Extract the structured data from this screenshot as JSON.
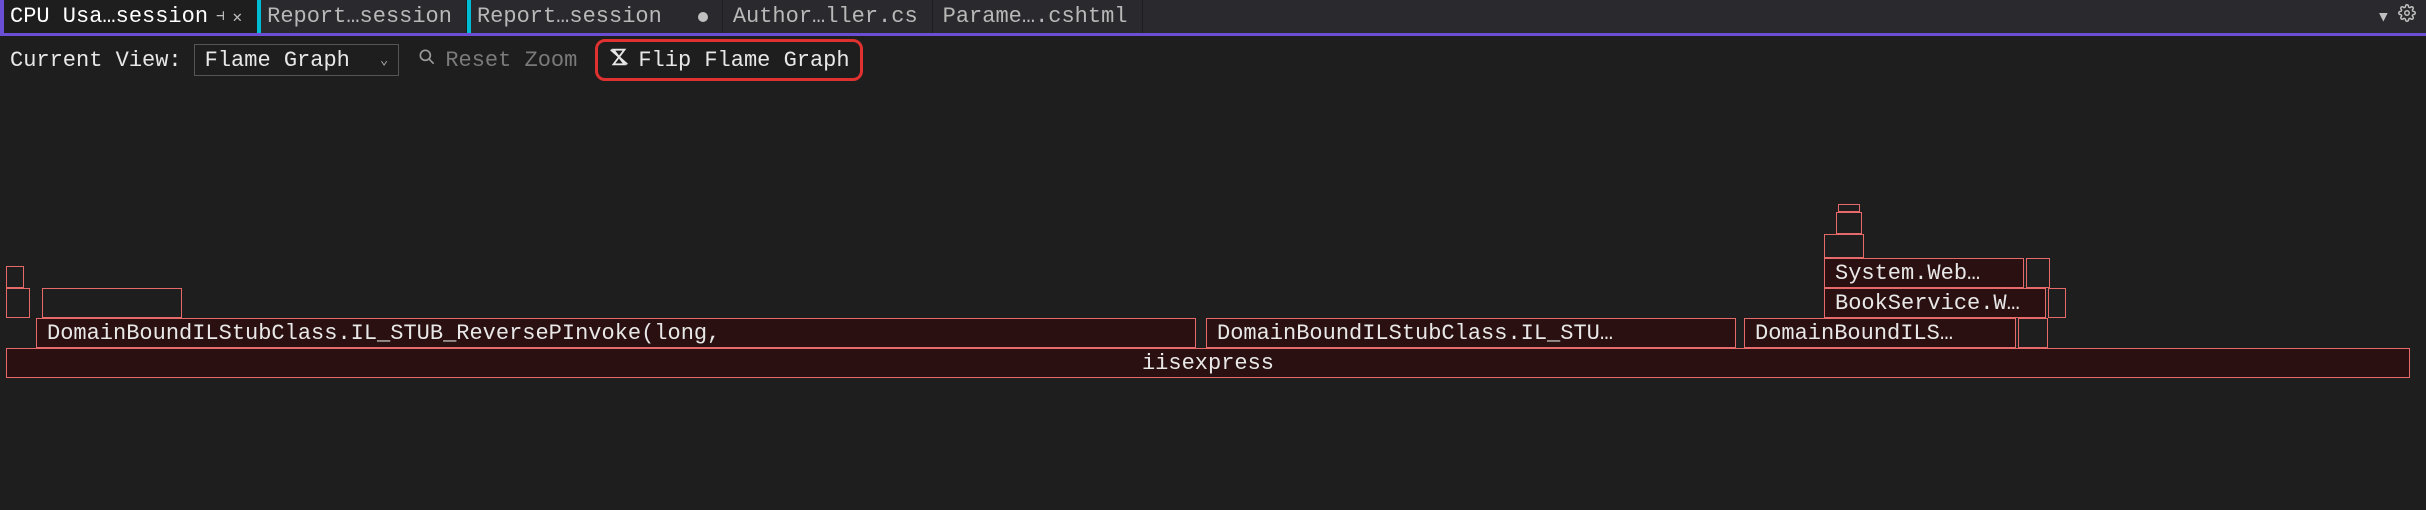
{
  "tabs": [
    {
      "label": "CPU Usa…session",
      "active": true,
      "pinned": true,
      "closable": true
    },
    {
      "label": "Report…session",
      "active": false
    },
    {
      "label": "Report…session",
      "active": false,
      "dirty": true
    },
    {
      "label": "Author…ller.cs",
      "active": false
    },
    {
      "label": "Parame….cshtml",
      "active": false
    }
  ],
  "toolbar": {
    "current_view_label": "Current View:",
    "view_dropdown": "Flame Graph",
    "reset_zoom": "Reset Zoom",
    "flip_flame": "Flip Flame Graph"
  },
  "flame": {
    "root": "iisexpress",
    "row2": [
      "DomainBoundILStubClass.IL_STUB_ReversePInvoke(long,",
      "DomainBoundILStubClass.IL_STU…",
      "DomainBoundILS…"
    ],
    "row3_right": "BookService.W…",
    "row4_right": "System.Web…"
  }
}
